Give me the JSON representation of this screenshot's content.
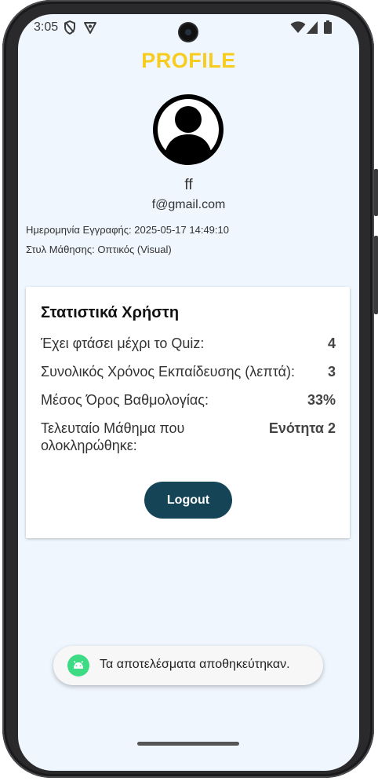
{
  "status_bar": {
    "time": "3:05"
  },
  "profile": {
    "title": "PROFILE",
    "username": "ff",
    "email": "f@gmail.com",
    "registration_label": "Ημερομηνία Εγγραφής: 2025-05-17 14:49:10",
    "learning_style_label": "Στυλ Μάθησης: Οπτικός (Visual)"
  },
  "stats": {
    "title": "Στατιστικά Χρήστη",
    "rows": [
      {
        "label": "Έχει φτάσει μέχρι το Quiz:",
        "value": "4"
      },
      {
        "label": "Συνολικός Χρόνος Εκπαίδευσης (λεπτά):",
        "value": "3"
      },
      {
        "label": "Μέσος Όρος Βαθμολογίας:",
        "value": "33%"
      },
      {
        "label_line1": "Τελευταίο Μάθημα που",
        "label_line2": "ολοκληρώθηκε:",
        "value": "Ενότητα 2"
      }
    ]
  },
  "logout_label": "Logout",
  "toast": {
    "text": "Τα αποτελέσματα αποθηκεύτηκαν."
  },
  "colors": {
    "title": "#f6cc1e",
    "button": "#154457",
    "background": "#eff6fe",
    "android_green": "#3ddc84"
  },
  "icons": {
    "avatar": "account-circle-icon",
    "status": [
      "shield-icon",
      "vpn-key-icon",
      "wifi-icon",
      "cellular-icon",
      "battery-icon"
    ],
    "toast": "android-icon"
  }
}
